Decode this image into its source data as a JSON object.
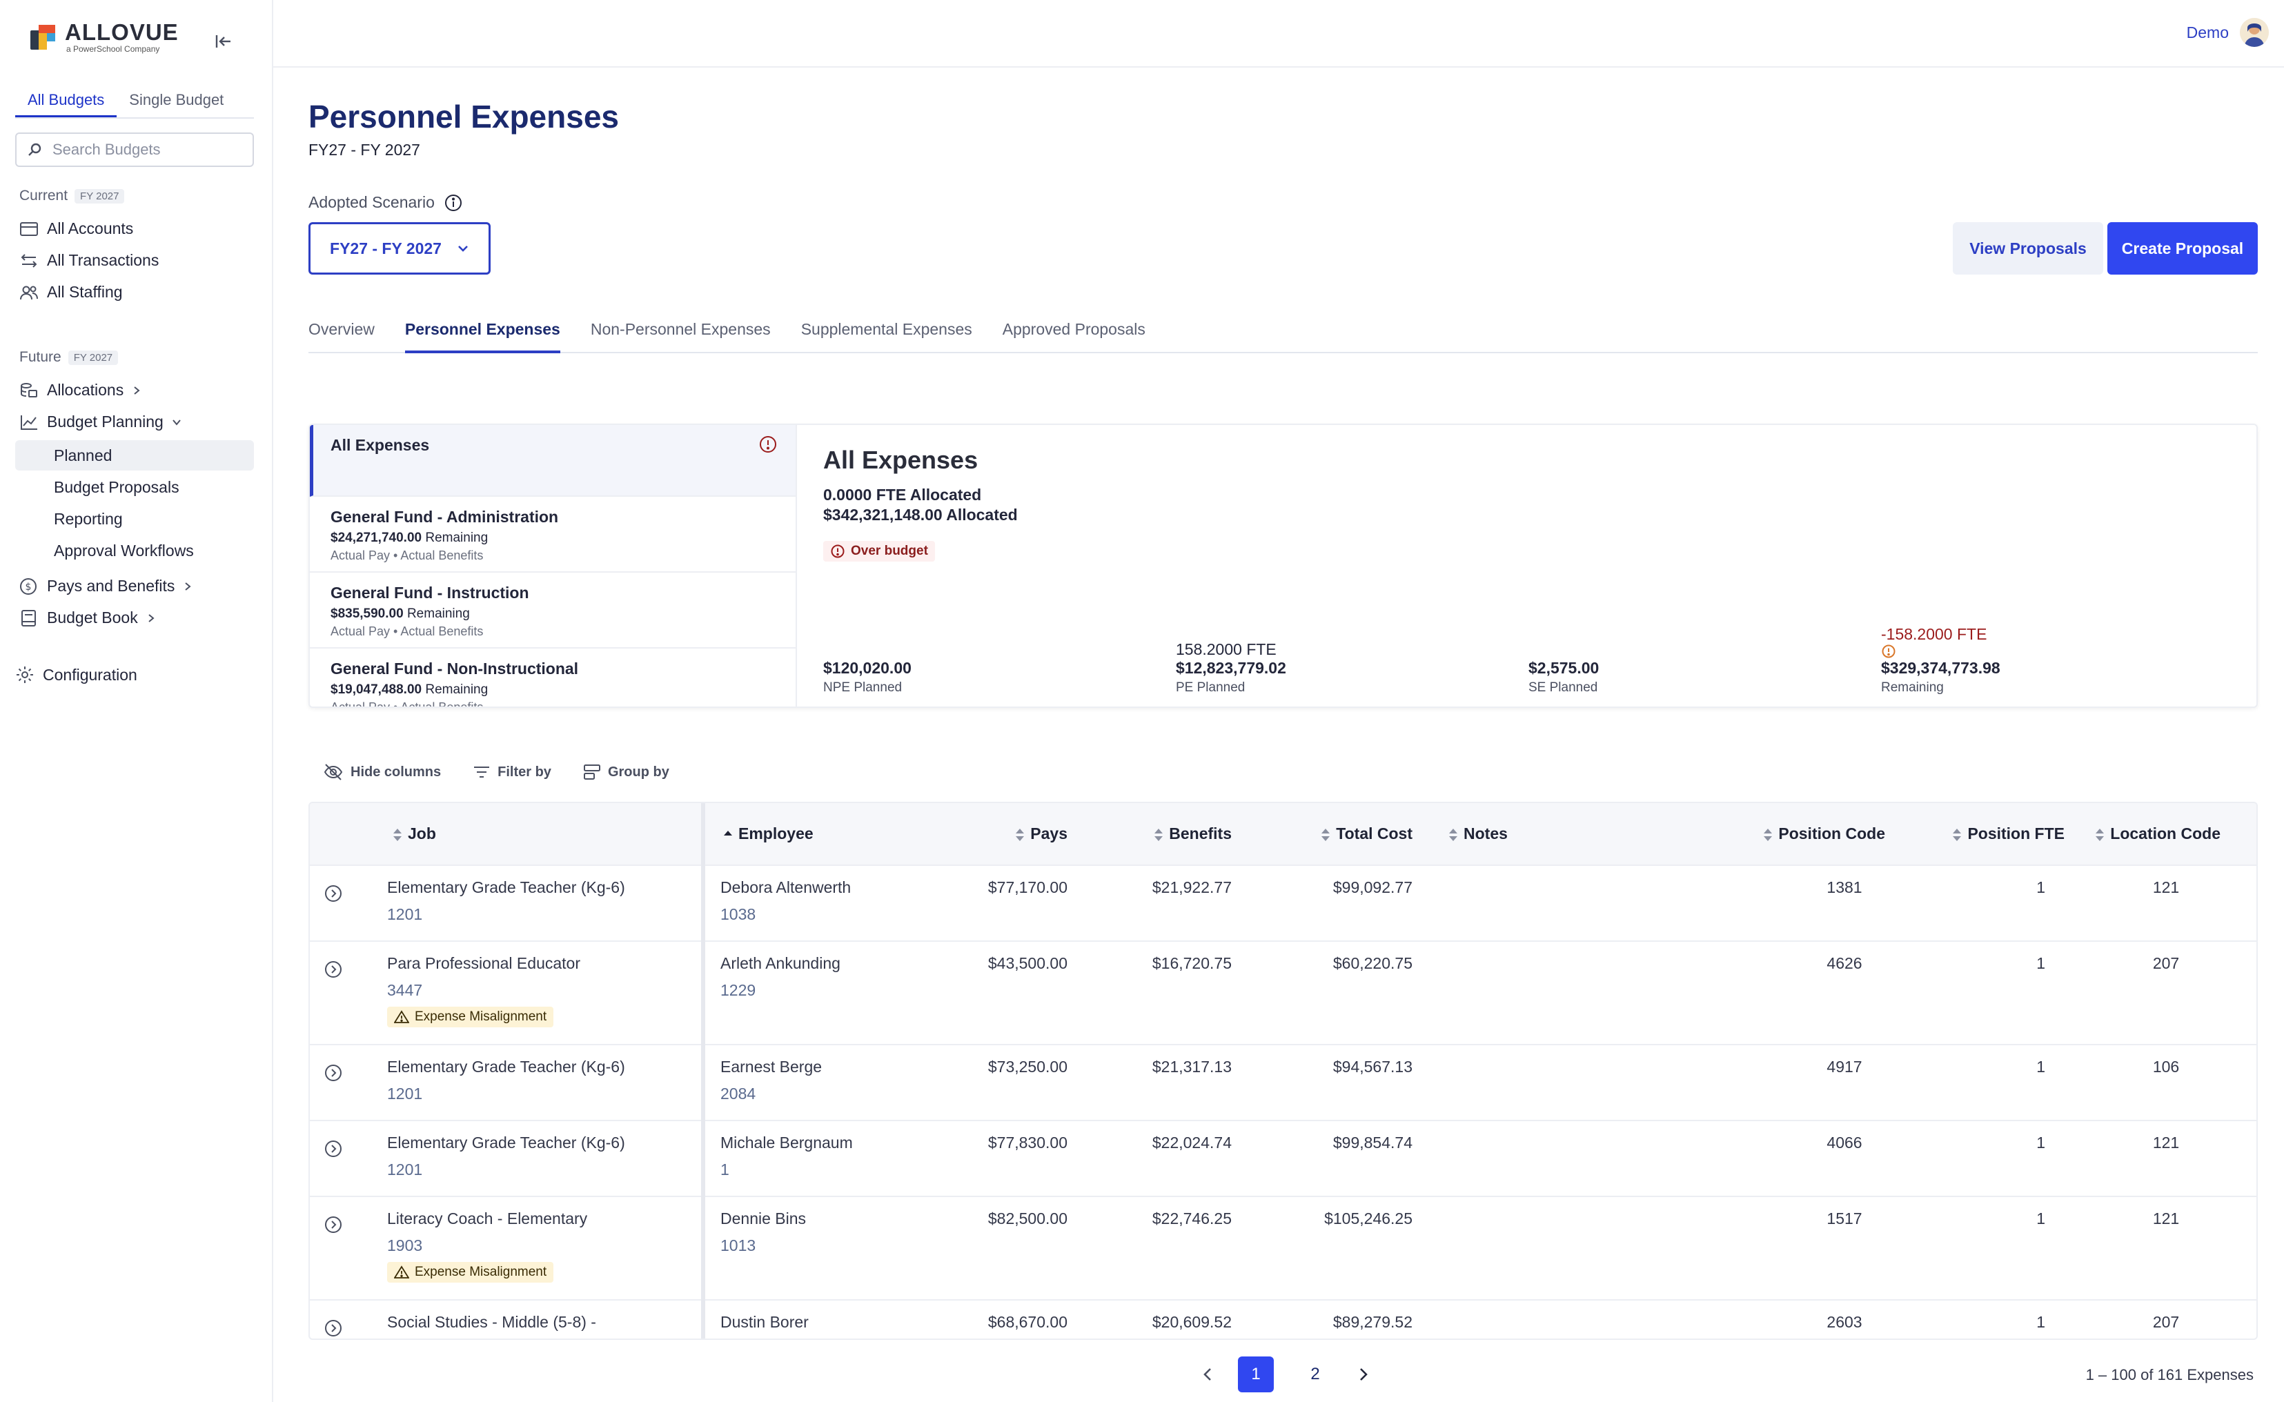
{
  "brand": {
    "name": "ALLOVUE",
    "tagline": "a PowerSchool Company"
  },
  "sidebar": {
    "tabs": [
      {
        "label": "All Budgets",
        "active": true
      },
      {
        "label": "Single Budget",
        "active": false
      }
    ],
    "search_placeholder": "Search Budgets",
    "current": {
      "label": "Current",
      "fy": "FY 2027"
    },
    "current_items": [
      "All Accounts",
      "All Transactions",
      "All Staffing"
    ],
    "future": {
      "label": "Future",
      "fy": "FY 2027"
    },
    "allocations": "Allocations",
    "budget_planning": "Budget Planning",
    "planning_subitems": [
      "Planned",
      "Budget Proposals",
      "Reporting",
      "Approval Workflows"
    ],
    "pays_benefits": "Pays and Benefits",
    "budget_book": "Budget Book",
    "configuration": "Configuration"
  },
  "header": {
    "user": "Demo"
  },
  "page": {
    "title": "Personnel Expenses",
    "subtitle": "FY27 - FY 2027",
    "scenario_label": "Adopted Scenario",
    "scenario_value": "FY27 - FY 2027",
    "view_proposals": "View Proposals",
    "create_proposal": "Create Proposal",
    "tabs": [
      "Overview",
      "Personnel Expenses",
      "Non-Personnel Expenses",
      "Supplemental Expenses",
      "Approved Proposals"
    ]
  },
  "expense_list": [
    {
      "name": "All Expenses"
    },
    {
      "name": "General Fund - Administration",
      "remaining": "$24,271,740.00",
      "remaining_label": "Remaining",
      "meta1": "Actual Pay",
      "meta2": "Actual Benefits"
    },
    {
      "name": "General Fund - Instruction",
      "remaining": "$835,590.00",
      "remaining_label": "Remaining",
      "meta1": "Actual Pay",
      "meta2": "Actual Benefits"
    },
    {
      "name": "General Fund - Non-Instructional",
      "remaining": "$19,047,488.00",
      "remaining_label": "Remaining",
      "meta1": "Actual Pay",
      "meta2": "Actual Benefits"
    }
  ],
  "expense_detail": {
    "title": "All Expenses",
    "fte_allocated": "0.0000 FTE Allocated",
    "amount_allocated": "$342,321,148.00 Allocated",
    "badge": "Over budget",
    "stats": [
      {
        "top": "",
        "value": "$120,020.00",
        "label": "NPE Planned"
      },
      {
        "top": "158.2000 FTE",
        "value": "$12,823,779.02",
        "label": "PE Planned"
      },
      {
        "top": "",
        "value": "$2,575.00",
        "label": "SE Planned"
      },
      {
        "top": "-158.2000 FTE",
        "value": "$329,374,773.98",
        "label": "Remaining"
      }
    ]
  },
  "toolbar": {
    "hide": "Hide columns",
    "filter": "Filter by",
    "group": "Group by"
  },
  "table": {
    "headers": [
      "Job",
      "Employee",
      "Pays",
      "Benefits",
      "Total Cost",
      "Notes",
      "Position Code",
      "Position FTE",
      "Location Code"
    ],
    "rows": [
      {
        "job": "Elementary Grade Teacher (Kg-6)",
        "job_code": "1201",
        "employee": "Debora Altenwerth",
        "emp_id": "1038",
        "pays": "$77,170.00",
        "benefits": "$21,922.77",
        "total": "$99,092.77",
        "notes": "",
        "position_code": "1381",
        "fte": "1",
        "location": "121",
        "flag": ""
      },
      {
        "job": "Para Professional Educator",
        "job_code": "3447",
        "employee": "Arleth Ankunding",
        "emp_id": "1229",
        "pays": "$43,500.00",
        "benefits": "$16,720.75",
        "total": "$60,220.75",
        "notes": "",
        "position_code": "4626",
        "fte": "1",
        "location": "207",
        "flag": "Expense Misalignment"
      },
      {
        "job": "Elementary Grade Teacher (Kg-6)",
        "job_code": "1201",
        "employee": "Earnest Berge",
        "emp_id": "2084",
        "pays": "$73,250.00",
        "benefits": "$21,317.13",
        "total": "$94,567.13",
        "notes": "",
        "position_code": "4917",
        "fte": "1",
        "location": "106",
        "flag": ""
      },
      {
        "job": "Elementary Grade Teacher (Kg-6)",
        "job_code": "1201",
        "employee": "Michale Bergnaum",
        "emp_id": "1",
        "pays": "$77,830.00",
        "benefits": "$22,024.74",
        "total": "$99,854.74",
        "notes": "",
        "position_code": "4066",
        "fte": "1",
        "location": "121",
        "flag": ""
      },
      {
        "job": "Literacy Coach - Elementary",
        "job_code": "1903",
        "employee": "Dennie Bins",
        "emp_id": "1013",
        "pays": "$82,500.00",
        "benefits": "$22,746.25",
        "total": "$105,246.25",
        "notes": "",
        "position_code": "1517",
        "fte": "1",
        "location": "121",
        "flag": "Expense Misalignment"
      },
      {
        "job": "Social Studies - Middle (5-8) -",
        "job_code": "",
        "employee": "Dustin Borer",
        "emp_id": "",
        "pays": "$68,670.00",
        "benefits": "$20,609.52",
        "total": "$89,279.52",
        "notes": "",
        "position_code": "2603",
        "fte": "1",
        "location": "207",
        "flag": ""
      }
    ]
  },
  "pagination": {
    "pages": [
      "1",
      "2"
    ],
    "current": "1",
    "summary": "1 – 100 of 161 Expenses"
  },
  "colors": {
    "primary": "#3047f0",
    "title": "#1b2a6e",
    "danger": "#9b1c1c",
    "warning_bg": "#fdf3d6"
  }
}
